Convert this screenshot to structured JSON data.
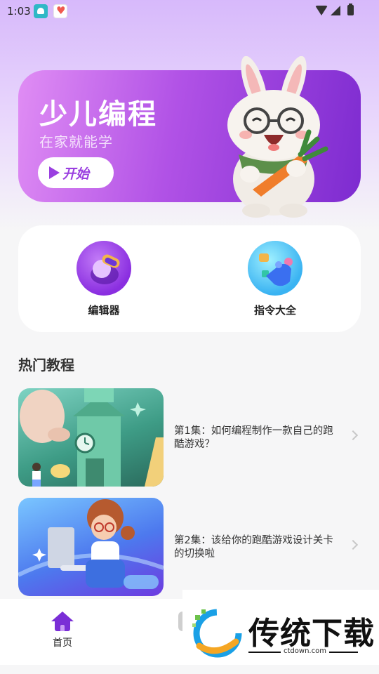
{
  "status_bar": {
    "time": "1:03"
  },
  "banner": {
    "title": "少儿编程",
    "subtitle": "在家就能学",
    "start_label": "开始"
  },
  "quick_entries": [
    {
      "label": "编辑器",
      "icon": "editor-icon"
    },
    {
      "label": "指令大全",
      "icon": "commands-icon"
    }
  ],
  "section": {
    "title": "热门教程"
  },
  "tutorials": [
    {
      "title": "第1集：如何编程制作一款自己的跑酷游戏？"
    },
    {
      "title": "第2集：该给你的跑酷游戏设计关卡的切换啦"
    }
  ],
  "bottom_nav": {
    "home_label": "首页"
  },
  "watermark": {
    "text": "传统下载",
    "url": "ctdown.com"
  },
  "colors": {
    "accent": "#7a2ed6",
    "banner_start": "#e08df4",
    "banner_end": "#7d2bd0"
  }
}
